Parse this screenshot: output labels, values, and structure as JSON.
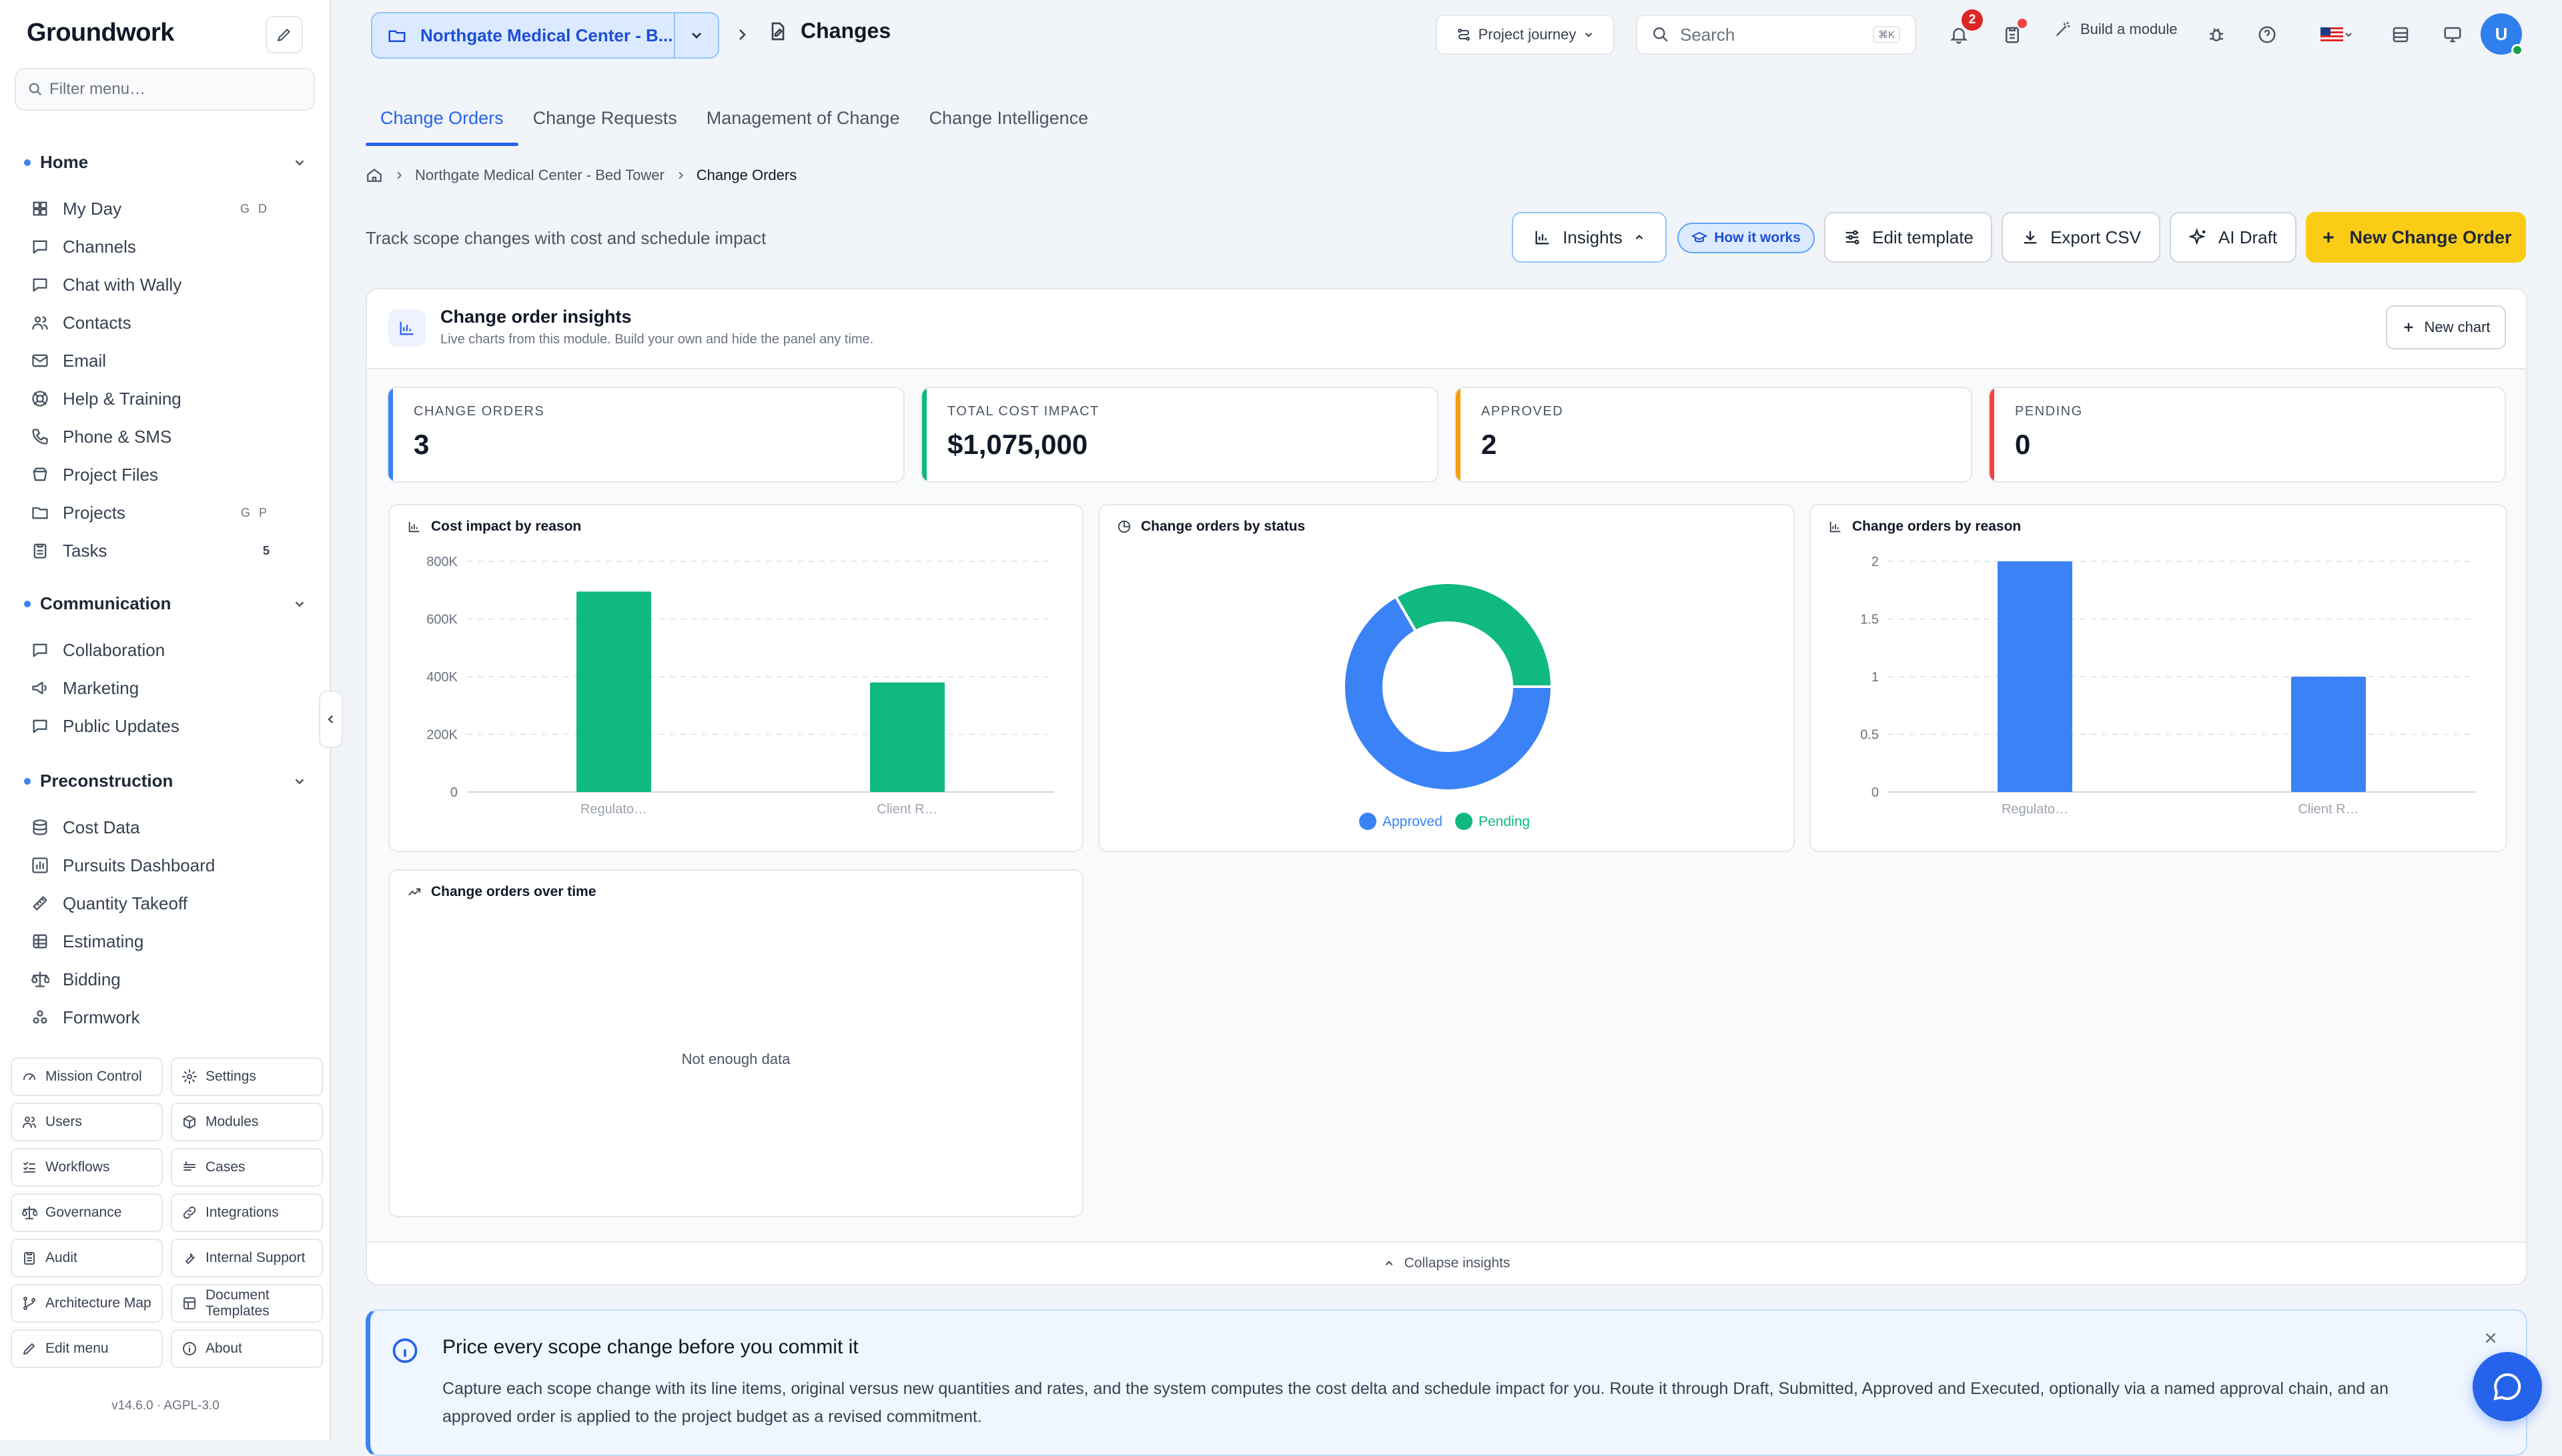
{
  "app": {
    "brand": "Groundwork",
    "version": "v14.6.0 · AGPL-3.0"
  },
  "sidebar": {
    "filter_placeholder": "Filter menu…",
    "sections": [
      {
        "title": "Home",
        "items": [
          {
            "label": "My Day",
            "kbd": "G D",
            "icon": "grid-icon"
          },
          {
            "label": "Channels",
            "icon": "chat-icon"
          },
          {
            "label": "Chat with Wally",
            "icon": "chat-icon"
          },
          {
            "label": "Contacts",
            "icon": "users-icon"
          },
          {
            "label": "Email",
            "icon": "mail-icon"
          },
          {
            "label": "Help & Training",
            "icon": "lifebuoy-icon"
          },
          {
            "label": "Phone & SMS",
            "icon": "phone-icon"
          },
          {
            "label": "Project Files",
            "icon": "drive-icon"
          },
          {
            "label": "Projects",
            "kbd": "G P",
            "icon": "folder-icon"
          },
          {
            "label": "Tasks",
            "count": "5",
            "icon": "clipboard-icon"
          }
        ]
      },
      {
        "title": "Communication",
        "items": [
          {
            "label": "Collaboration",
            "icon": "chat-icon"
          },
          {
            "label": "Marketing",
            "icon": "megaphone-icon"
          },
          {
            "label": "Public Updates",
            "icon": "chat-icon"
          }
        ]
      },
      {
        "title": "Preconstruction",
        "items": [
          {
            "label": "Cost Data",
            "icon": "database-icon"
          },
          {
            "label": "Pursuits Dashboard",
            "icon": "chart-icon"
          },
          {
            "label": "Quantity Takeoff",
            "icon": "ruler-icon"
          },
          {
            "label": "Estimating",
            "icon": "table-icon"
          },
          {
            "label": "Bidding",
            "icon": "scale-icon"
          },
          {
            "label": "Formwork",
            "icon": "boxes-icon"
          }
        ]
      }
    ],
    "bottom_buttons": [
      {
        "label": "Mission Control",
        "icon": "gauge-icon"
      },
      {
        "label": "Settings",
        "icon": "gear-icon"
      },
      {
        "label": "Users",
        "icon": "users-icon"
      },
      {
        "label": "Modules",
        "icon": "cube-icon"
      },
      {
        "label": "Workflows",
        "icon": "list-check-icon"
      },
      {
        "label": "Cases",
        "icon": "cases-icon"
      },
      {
        "label": "Governance",
        "icon": "scale-icon"
      },
      {
        "label": "Integrations",
        "icon": "link-icon"
      },
      {
        "label": "Audit",
        "icon": "clipboard-icon"
      },
      {
        "label": "Internal Support",
        "icon": "wrench-icon"
      },
      {
        "label": "Architecture Map",
        "icon": "branch-icon"
      },
      {
        "label": "Document Templates",
        "icon": "template-icon"
      },
      {
        "label": "Edit menu",
        "icon": "pencil-icon"
      },
      {
        "label": "About",
        "icon": "info-icon"
      }
    ]
  },
  "topbar": {
    "project": "Northgate Medical Center - B...",
    "page_title": "Changes",
    "journey": "Project journey",
    "search_placeholder": "Search",
    "search_kbd": "⌘K",
    "notif_count": "2",
    "build": "Build a module"
  },
  "tabs": [
    "Change Orders",
    "Change Requests",
    "Management of Change",
    "Change Intelligence"
  ],
  "breadcrumb": {
    "project": "Northgate Medical Center - Bed Tower",
    "current": "Change Orders"
  },
  "subtitle": "Track scope changes with cost and schedule impact",
  "actions": {
    "insights": "Insights",
    "how": "How it works",
    "edit_template": "Edit template",
    "export": "Export CSV",
    "ai_draft": "AI Draft",
    "new_co": "New Change Order"
  },
  "insights": {
    "title": "Change order insights",
    "subtitle": "Live charts from this module. Build your own and hide the panel any time.",
    "new_chart": "New chart",
    "collapse": "Collapse insights",
    "kpis": [
      {
        "label": "CHANGE ORDERS",
        "value": "3",
        "color": "#3b82f6"
      },
      {
        "label": "TOTAL COST IMPACT",
        "value": "$1,075,000",
        "color": "#10b981"
      },
      {
        "label": "APPROVED",
        "value": "2",
        "color": "#f59e0b"
      },
      {
        "label": "PENDING",
        "value": "0",
        "color": "#ef4444"
      }
    ],
    "card_titles": {
      "cost": "Cost impact by reason",
      "status": "Change orders by status",
      "reason": "Change orders by reason",
      "time": "Change orders over time"
    },
    "no_data": "Not enough data"
  },
  "chart_data": [
    {
      "type": "bar",
      "title": "Cost impact by reason",
      "categories": [
        "Regulato…",
        "Client R…"
      ],
      "values": [
        695000,
        380000
      ],
      "ylim": [
        0,
        800000
      ],
      "yticks": [
        "0",
        "200K",
        "400K",
        "600K",
        "800K"
      ],
      "ytick_values": [
        0,
        200000,
        400000,
        600000,
        800000
      ],
      "color": "#10b981",
      "grid": true
    },
    {
      "type": "pie",
      "title": "Change orders by status",
      "categories": [
        "Approved",
        "Pending"
      ],
      "values": [
        2,
        1
      ],
      "colors": [
        "#3b82f6",
        "#10b981"
      ],
      "legend": "bottom"
    },
    {
      "type": "bar",
      "title": "Change orders by reason",
      "categories": [
        "Regulato…",
        "Client R…"
      ],
      "values": [
        2,
        1
      ],
      "ylim": [
        0,
        2
      ],
      "yticks": [
        "0",
        "0.5",
        "1",
        "1.5",
        "2"
      ],
      "ytick_values": [
        0,
        0.5,
        1,
        1.5,
        2
      ],
      "color": "#3b82f6",
      "grid": true
    }
  ],
  "banner": {
    "title": "Price every scope change before you commit it",
    "body": "Capture each scope change with its line items, original versus new quantities and rates, and the system computes the cost delta and schedule impact for you. Route it through Draft, Submitted, Approved and Executed, optionally via a named approval chain, and an approved order is applied to the project budget as a revised commitment."
  }
}
